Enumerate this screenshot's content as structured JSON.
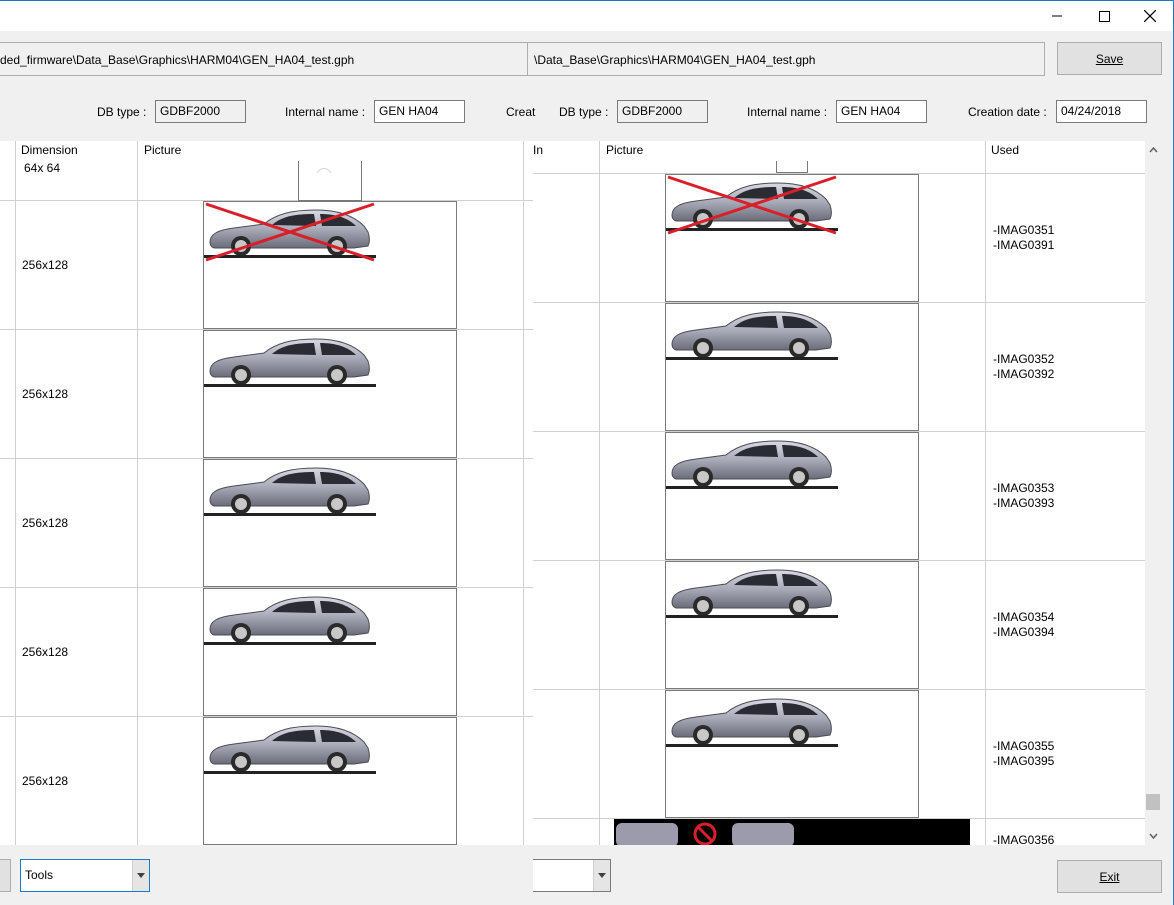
{
  "window": {
    "minimize_icon": "minimize-icon",
    "maximize_icon": "maximize-icon",
    "close_icon": "close-icon"
  },
  "left_panel": {
    "path": "ded_firmware\\Data_Base\\Graphics\\HARM04\\GEN_HA04_test.gph",
    "db_type_label": "DB type :",
    "db_type_value": "GDBF2000",
    "internal_name_label": "Internal name :",
    "internal_name_value": "GEN HA04",
    "creation_label_truncated": "Creat",
    "columns": {
      "dimension": "Dimension",
      "picture": "Picture"
    },
    "rows": [
      {
        "dimension": "64x 64"
      },
      {
        "dimension": "256x128"
      },
      {
        "dimension": "256x128"
      },
      {
        "dimension": "256x128"
      },
      {
        "dimension": "256x128"
      },
      {
        "dimension": "256x128"
      }
    ],
    "tools_combo": "Tools"
  },
  "right_panel": {
    "path": "\\Data_Base\\Graphics\\HARM04\\GEN_HA04_test.gph",
    "save_button": "Save",
    "db_type_label": "DB type :",
    "db_type_value": "GDBF2000",
    "internal_name_label": "Internal name :",
    "internal_name_value": "GEN HA04",
    "creation_date_label": "Creation date :",
    "creation_date_value": "04/24/2018",
    "columns": {
      "in": "In",
      "picture": "Picture",
      "used": "Used"
    },
    "rows": [
      {
        "used": [
          "-IMAG0351",
          "-IMAG0391"
        ]
      },
      {
        "used": [
          "-IMAG0352",
          "-IMAG0392"
        ]
      },
      {
        "used": [
          "-IMAG0353",
          "-IMAG0393"
        ]
      },
      {
        "used": [
          "-IMAG0354",
          "-IMAG0394"
        ]
      },
      {
        "used": [
          "-IMAG0355",
          "-IMAG0395"
        ]
      },
      {
        "used": [
          "-IMAG0356"
        ]
      }
    ],
    "combo_value": "",
    "exit_button": "Exit"
  },
  "colors": {
    "accent": "#1979ca",
    "cross": "#d81f2a",
    "car_body": "#b4b5c2"
  }
}
